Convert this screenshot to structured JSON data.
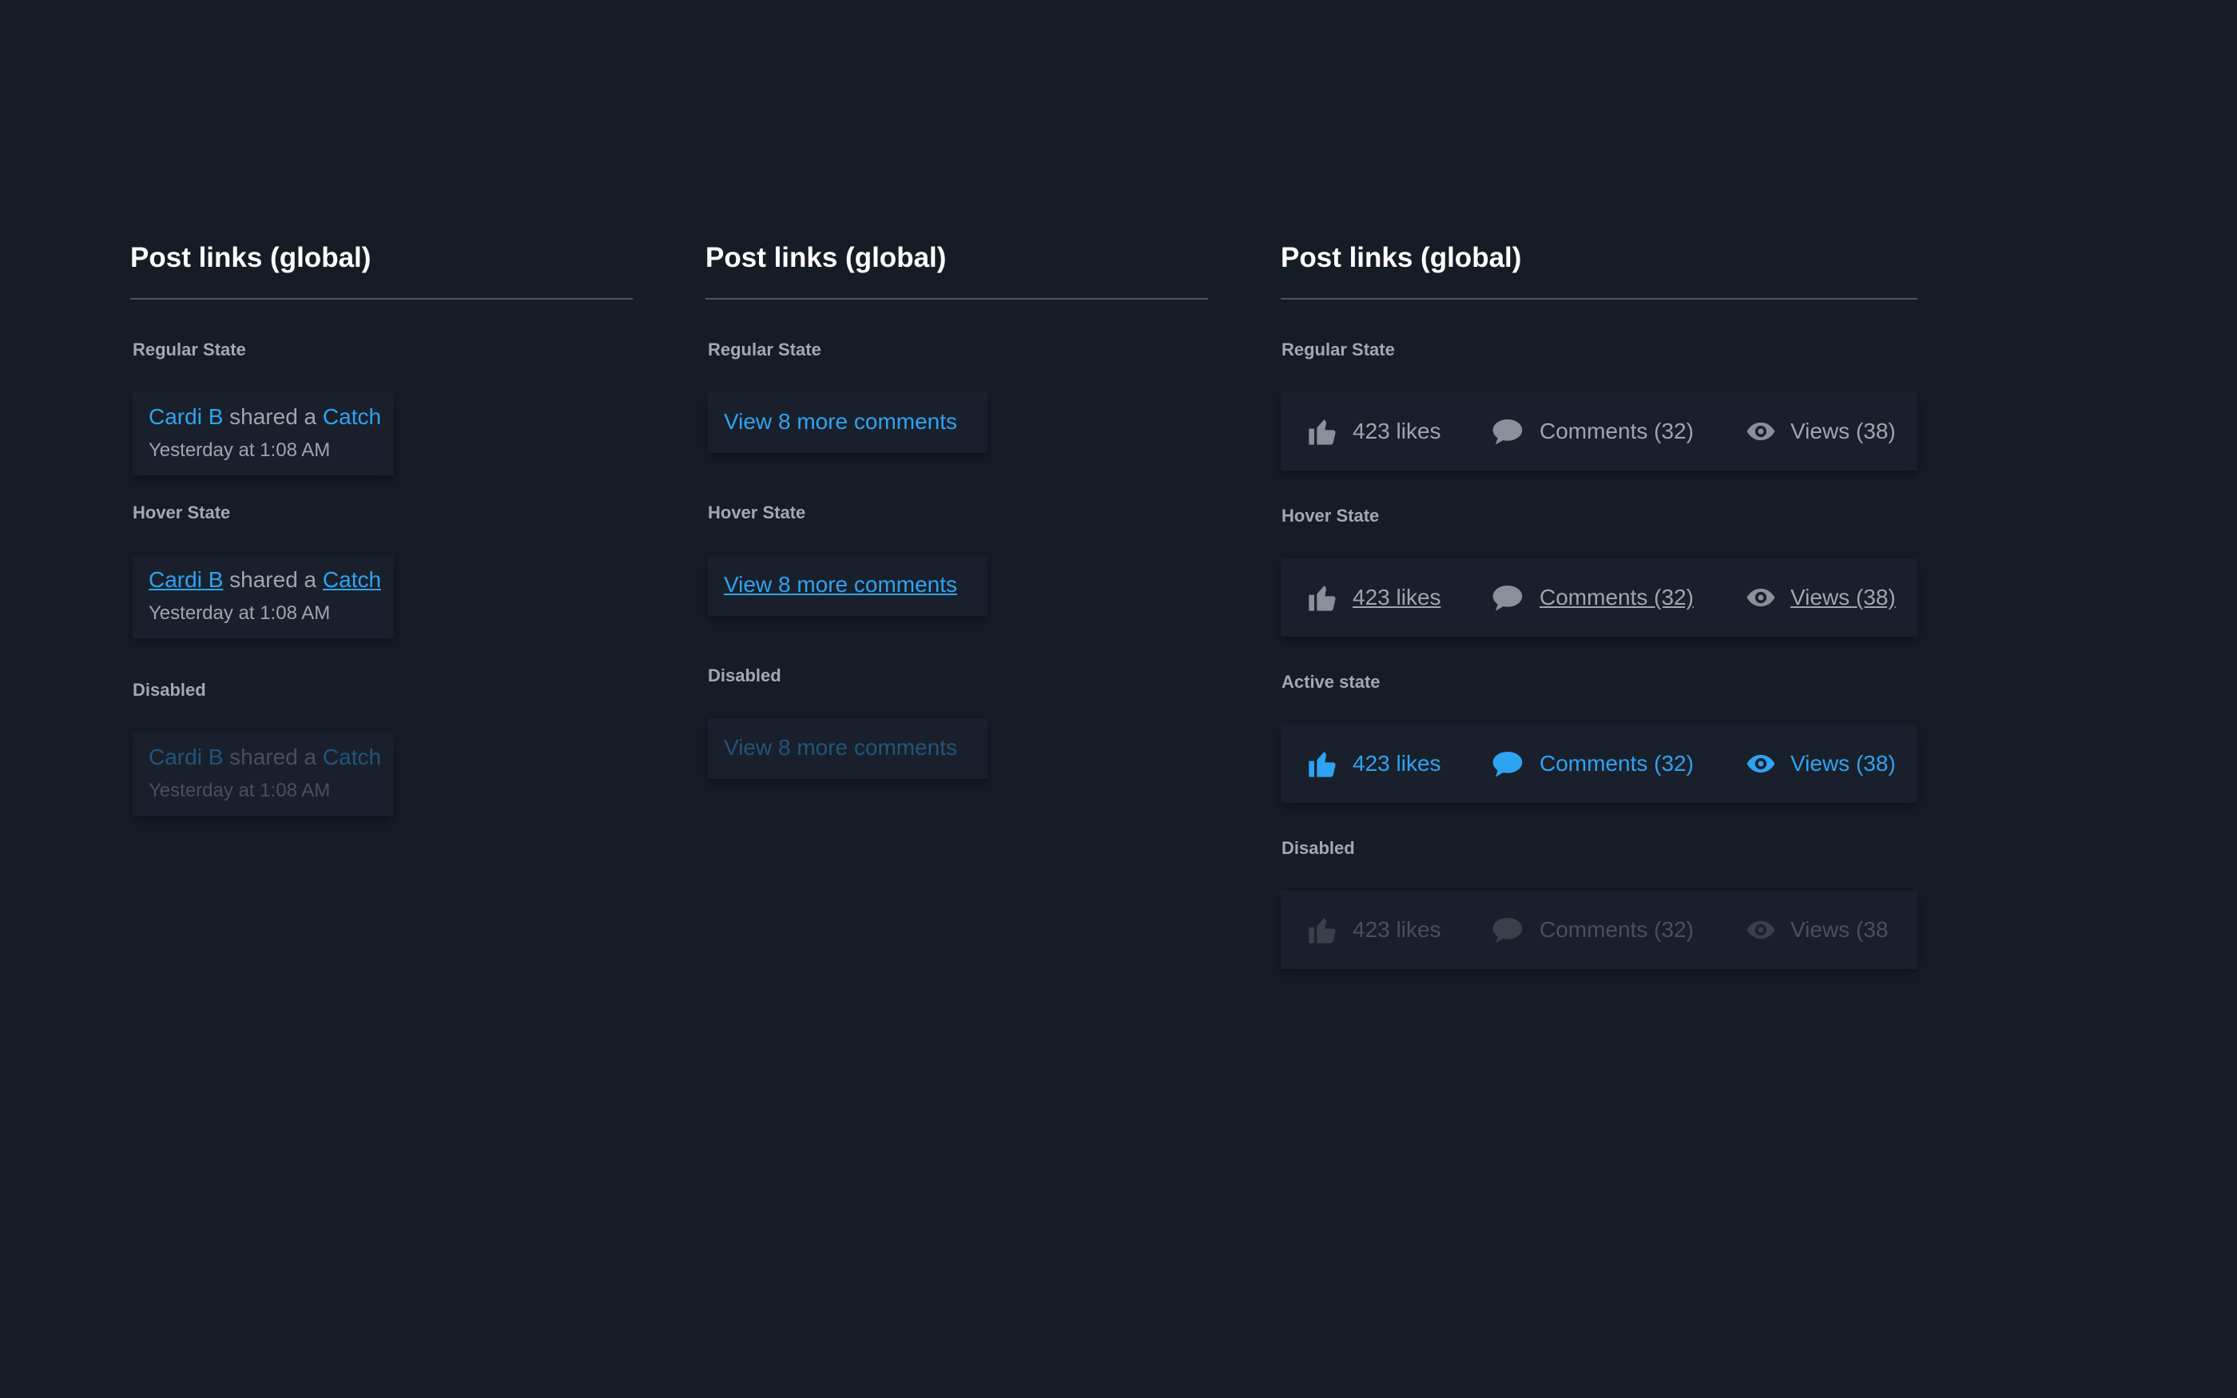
{
  "col1": {
    "title": "Post links (global)",
    "regular": {
      "label": "Regular State",
      "author": "Cardi B",
      "action": " shared a ",
      "object": "Catch",
      "time": "Yesterday at 1:08 AM"
    },
    "hover": {
      "label": "Hover State",
      "author": "Cardi B",
      "action": " shared a ",
      "object": "Catch",
      "time": "Yesterday at 1:08 AM"
    },
    "disabled": {
      "label": "Disabled",
      "author": "Cardi B",
      "action": " shared a ",
      "object": "Catch",
      "time": "Yesterday at 1:08 AM"
    }
  },
  "col2": {
    "title": "Post links (global)",
    "regular": {
      "label": "Regular State",
      "link": "View 8 more comments"
    },
    "hover": {
      "label": "Hover State",
      "link": "View 8 more comments"
    },
    "disabled": {
      "label": "Disabled",
      "link": "View 8 more comments"
    }
  },
  "col3": {
    "title": "Post links (global)",
    "regular": {
      "label": "Regular State",
      "likes": "423 likes",
      "comments": "Comments (32)",
      "views": "Views (38)"
    },
    "hover": {
      "label": "Hover State",
      "likes": "423 likes",
      "comments": "Comments (32)",
      "views": "Views (38)"
    },
    "active": {
      "label": "Active state",
      "likes": "423 likes",
      "comments": "Comments (32)",
      "views": "Views (38)"
    },
    "disabled": {
      "label": "Disabled",
      "likes": "423 likes",
      "comments": "Comments (32)",
      "views": "Views (38"
    }
  },
  "icons": {
    "like": "thumbs-up-icon",
    "comment": "speech-bubble-icon",
    "view": "eye-icon"
  },
  "colors": {
    "background": "#161c26",
    "card": "#19202b",
    "link": "#2ea3f2",
    "text": "#a0a5ad",
    "disabled_link": "#23547a",
    "disabled_text": "#4a505a"
  }
}
